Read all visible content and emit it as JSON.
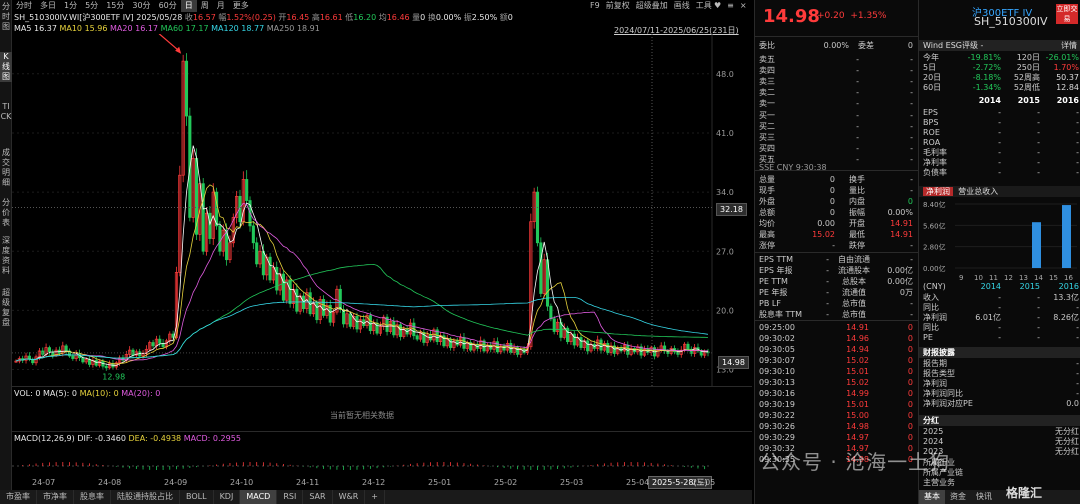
{
  "left_strip": [
    "分时图",
    "K线图",
    "TICK",
    "成交明细",
    "分价表",
    "深度资料",
    "超级复盘"
  ],
  "toolbar": {
    "items": [
      "分时",
      "多日",
      "1分",
      "5分",
      "15分",
      "30分",
      "60分",
      "日",
      "周",
      "月",
      "更多"
    ],
    "active": "日",
    "right_menu": [
      "F9",
      "前复权",
      "超级叠加",
      "画线",
      "工具"
    ],
    "window_controls": [
      "♥",
      "≡",
      "×"
    ]
  },
  "info_line": {
    "symbol": "SH_510300IV.WI[沪300ETF IV]",
    "date": "2025/05/28",
    "收_label": "收",
    "收": "16.57",
    "幅_label": "幅",
    "幅": "1.52%(0.25)",
    "开_label": "开",
    "开": "16.45",
    "高_label": "高",
    "高": "16.61",
    "低_label": "低",
    "低": "16.20",
    "均_label": "均",
    "均": "16.46",
    "量_label": "量",
    "量": "0",
    "换_label": "换",
    "换": "0.00%",
    "振_label": "振",
    "振": "2.50%",
    "额_label": "额",
    "额": "0"
  },
  "ma_line": {
    "ma5": "MA5 16.37",
    "ma10": "MA10 15.96",
    "ma20": "MA20 16.17",
    "ma60": "MA60 17.17",
    "ma120": "MA120 18.77",
    "ma250": "MA250 18.91",
    "date_range": "2024/07/11-2025/06/25(231日)"
  },
  "chart_data": {
    "type": "candlestick",
    "y_ticks": [
      "48.0",
      "41.0",
      "34.0",
      "27.0",
      "20.0",
      "13.0"
    ],
    "ylim": [
      12.0,
      52.0
    ],
    "x_ticks": [
      "24-07",
      "24-08",
      "24-09",
      "24-10",
      "24-11",
      "24-12",
      "25-01",
      "25-02",
      "25-03",
      "25-04",
      "25-05"
    ],
    "annotations": {
      "peak": "50.37",
      "low": "12.98"
    },
    "crosshair_price": "32.18",
    "last_price_tag": "14.98",
    "date_box": "2025-5-28(三)",
    "close_series": [
      14,
      14.3,
      14.1,
      14.6,
      14.2,
      13.8,
      14.5,
      15.2,
      14.8,
      15.6,
      15.1,
      14.7,
      15.3,
      14.9,
      15.8,
      15.2,
      14.6,
      14.3,
      14.9,
      14.4,
      13.9,
      14.2,
      13.6,
      14.1,
      13.5,
      14,
      13.4,
      13.2,
      13.7,
      13.3,
      13.8,
      14.4,
      14.1,
      14.8,
      15.3,
      14.7,
      15.1,
      14.6,
      14.9,
      15.4,
      16.2,
      15.8,
      16.6,
      16.1,
      15.7,
      16.4,
      17.2,
      16.8,
      24.5,
      36,
      49.5,
      43,
      31,
      38,
      29,
      35,
      27,
      31.5,
      28.5,
      34,
      30,
      27,
      29.5,
      26,
      28,
      31,
      33.5,
      30.5,
      35.5,
      33,
      30,
      28,
      25.5,
      27,
      24.2,
      26.3,
      23.6,
      25.1,
      22.4,
      24.3,
      21.2,
      23.6,
      20.8,
      22.5,
      19.9,
      21.7,
      20.2,
      22.1,
      19.6,
      20.9,
      18.9,
      21.3,
      19.4,
      20.6,
      18.6,
      19.8,
      22.5,
      20.1,
      18.4,
      19.6,
      18.1,
      19.3,
      17.8,
      18.9,
      18.2,
      19.4,
      17.6,
      18.5,
      17.3,
      18.1,
      19.2,
      17.5,
      18.7,
      17.1,
      18.3,
      16.9,
      17.8,
      17.2,
      18.5,
      17,
      16.6,
      17.4,
      16.2,
      17.1,
      16.5,
      17.7,
      16.3,
      17,
      15.8,
      16.6,
      15.6,
      16.4,
      15.9,
      16.8,
      15.5,
      16.2,
      15.3,
      16,
      15.5,
      16.4,
      15.2,
      15.9,
      15.4,
      16.3,
      15.1,
      15.8,
      15.3,
      16.1,
      15,
      15.6,
      14.8,
      15.4,
      15,
      15.7,
      30.5,
      34,
      28,
      22,
      26,
      20.5,
      19,
      17.5,
      18.6,
      16.8,
      17.9,
      16.3,
      17.2,
      15.9,
      16.8,
      15.6,
      16.4,
      15.2,
      16,
      15.5,
      16.5,
      15.3,
      16.1,
      15,
      15.8,
      14.9,
      15.6,
      15.2,
      15.9,
      14.8,
      15.5,
      15.1,
      15.7,
      14.7,
      15.4,
      15,
      15.6,
      14.6,
      15.3,
      15.8,
      15.2,
      14.9,
      15.5,
      15.1,
      14.8,
      15.3,
      16,
      15.4,
      14.9,
      15.6,
      15.2,
      14.7,
      15.1,
      14.98
    ],
    "volume_text": "当前暂无相关数据"
  },
  "vol_line": {
    "label": "VOL: 0",
    "ma5": "MA(5): 0",
    "ma10": "MA(10): 0",
    "ma20": "MA(20): 0"
  },
  "macd_line": {
    "label": "MACD(12,26,9)",
    "dif": "DIF: -0.3460",
    "dea": "DEA: -0.4938",
    "macd": "MACD: 0.2955"
  },
  "bottom_tabs": [
    "市盈率",
    "市净率",
    "股息率",
    "陆股通持股占比",
    "BOLL",
    "KDJ",
    "MACD",
    "RSI",
    "SAR",
    "W&R",
    "+"
  ],
  "bottom_tab_active": "MACD",
  "order_book": {
    "price": "14.98",
    "change": "+0.20",
    "pct": "+1.35%",
    "委比_label": "委比",
    "委比": "0.00%",
    "委差_label": "委差",
    "委差": "0",
    "asks": [
      {
        "label": "卖五",
        "p": "-",
        "v": "-"
      },
      {
        "label": "卖四",
        "p": "-",
        "v": "-"
      },
      {
        "label": "卖三",
        "p": "-",
        "v": "-"
      },
      {
        "label": "卖二",
        "p": "-",
        "v": "-"
      },
      {
        "label": "卖一",
        "p": "-",
        "v": "-"
      }
    ],
    "bids": [
      {
        "label": "买一",
        "p": "-",
        "v": "-"
      },
      {
        "label": "买二",
        "p": "-",
        "v": "-"
      },
      {
        "label": "买三",
        "p": "-",
        "v": "-"
      },
      {
        "label": "买四",
        "p": "-",
        "v": "-"
      },
      {
        "label": "买五",
        "p": "-",
        "v": "-"
      }
    ],
    "tz_line": "SSE  CNY  9:30:38",
    "stats": [
      [
        "总量",
        "0",
        "换手",
        "-"
      ],
      [
        "现手",
        "0",
        "量比",
        "-"
      ],
      [
        "外盘",
        "0",
        "内盘",
        "0"
      ],
      [
        "总额",
        "0",
        "振幅",
        "0.00%"
      ],
      [
        "均价",
        "0.00",
        "开盘",
        "14.91"
      ],
      [
        "最高",
        "15.02",
        "最低",
        "14.91"
      ],
      [
        "涨停",
        "-",
        "跌停",
        "-"
      ]
    ],
    "fund": [
      [
        "EPS TTM",
        "-",
        "自由流通",
        "-"
      ],
      [
        "EPS 年报",
        "-",
        "流通股本",
        "0.00亿"
      ],
      [
        "PE TTM",
        "-",
        "总股本",
        "0.00亿"
      ],
      [
        "PE 年报",
        "-",
        "流通值",
        "0万"
      ],
      [
        "PB LF",
        "-",
        "总市值",
        "-"
      ],
      [
        "股息率 TTM",
        "-",
        "总市值",
        "-"
      ]
    ],
    "ticks": [
      [
        "09:25:00",
        "14.91",
        "0"
      ],
      [
        "09:30:02",
        "14.96",
        "0"
      ],
      [
        "09:30:05",
        "14.94",
        "0"
      ],
      [
        "09:30:07",
        "15.02",
        "0"
      ],
      [
        "09:30:10",
        "15.01",
        "0"
      ],
      [
        "09:30:13",
        "15.02",
        "0"
      ],
      [
        "09:30:16",
        "14.99",
        "0"
      ],
      [
        "09:30:19",
        "15.01",
        "0"
      ],
      [
        "09:30:22",
        "15.00",
        "0"
      ],
      [
        "09:30:26",
        "14.98",
        "0"
      ],
      [
        "09:30:29",
        "14.97",
        "0"
      ],
      [
        "09:30:32",
        "14.97",
        "0"
      ],
      [
        "09:30:35",
        "14.98",
        "0"
      ]
    ]
  },
  "info_panel": {
    "title": "沪300ETF IV",
    "code": "SH_510300IV",
    "badge": "立即交易",
    "esg_label": "Wind ESG评级",
    "esg_value": "-",
    "detail_link": "详情",
    "perf": [
      [
        "今年",
        "-19.81%",
        "120日",
        "-26.01%"
      ],
      [
        "5日",
        "-2.72%",
        "250日",
        "1.70%"
      ],
      [
        "20日",
        "-8.18%",
        "52周高",
        "50.37"
      ],
      [
        "60日",
        "-1.34%",
        "52周低",
        "12.84"
      ]
    ],
    "years": [
      "2014",
      "2015",
      "2016"
    ],
    "ratios": [
      "EPS",
      "BPS",
      "ROE",
      "ROA",
      "毛利率",
      "净利率",
      "负债率"
    ],
    "profit_tab": "净利润",
    "revenue_tab": "营业总收入",
    "rev_chart": {
      "y_ticks": [
        "8.40亿",
        "5.60亿",
        "2.80亿",
        "0.00亿"
      ],
      "x_ticks": [
        "9",
        "10",
        "11",
        "12",
        "13",
        "14",
        "15",
        "16"
      ],
      "values": [
        0,
        0,
        0,
        0,
        0,
        6.01,
        0,
        8.26
      ]
    },
    "cny_label": "(CNY)",
    "table": [
      [
        "收入",
        "-",
        "-",
        "13.3亿"
      ],
      [
        "同比",
        "-",
        "-",
        "-"
      ],
      [
        "净利润",
        "6.01亿",
        "-",
        "8.26亿"
      ],
      [
        "同比",
        "-",
        "-",
        "-"
      ],
      [
        "PE",
        "-",
        "-",
        "-"
      ]
    ],
    "disclosure_title": "财报披露",
    "disclosure": [
      [
        "报告期",
        "-"
      ],
      [
        "报告类型",
        "-"
      ],
      [
        "净利润",
        "-"
      ],
      [
        "净利润同比",
        "-"
      ],
      [
        "净利润对应PE",
        "0.0"
      ]
    ],
    "dividend_title": "分红",
    "dividend": [
      [
        "2025",
        "无分红"
      ],
      [
        "2024",
        "无分红"
      ],
      [
        "2023",
        "无分红"
      ]
    ],
    "extra": [
      "所属行业",
      "所属产业链",
      "主营业务"
    ],
    "bottom_tabs": [
      "基本",
      "资金",
      "快讯"
    ]
  },
  "watermark": "公众号 · 沧海一土狗",
  "logo": "格隆汇",
  "colors": {
    "up": "#ff3b3b",
    "down": "#22c85a",
    "ma5": "#ffffff",
    "ma10": "#e6d23c",
    "ma20": "#e05ce0",
    "ma60": "#22c85a",
    "ma120": "#36d6e6",
    "ma250": "#8a8a8a"
  }
}
